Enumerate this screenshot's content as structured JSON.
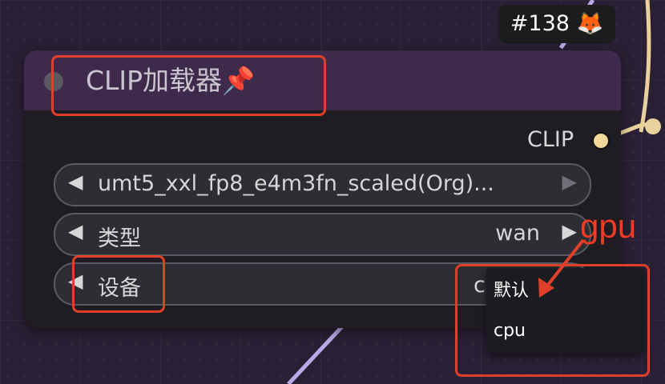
{
  "badge": {
    "label": "#138 🦊"
  },
  "node": {
    "title": "CLIP加载器📌",
    "output": {
      "label": "CLIP"
    },
    "widgets": [
      {
        "left_arrow": "◀",
        "label": "umt5_xxl_fp8_e4m3fn_scaled(Org)...",
        "value": "",
        "right_arrow": "▶"
      },
      {
        "left_arrow": "◀",
        "label": "类型",
        "value": "wan",
        "right_arrow": "▶"
      },
      {
        "left_arrow": "◀",
        "label": "设备",
        "value": "c",
        "right_arrow": ""
      }
    ]
  },
  "dropdown": {
    "options": [
      {
        "label": "默认"
      },
      {
        "label": "cpu"
      }
    ]
  },
  "annotation": {
    "text": "gpu",
    "color": "#ee3b24"
  },
  "colors": {
    "node_header": "#3e2a4a",
    "node_body": "#1f1d22",
    "wire_clip": "#e8d19c",
    "wire_other": "#b9a9e6",
    "annotation": "#e0402a"
  }
}
